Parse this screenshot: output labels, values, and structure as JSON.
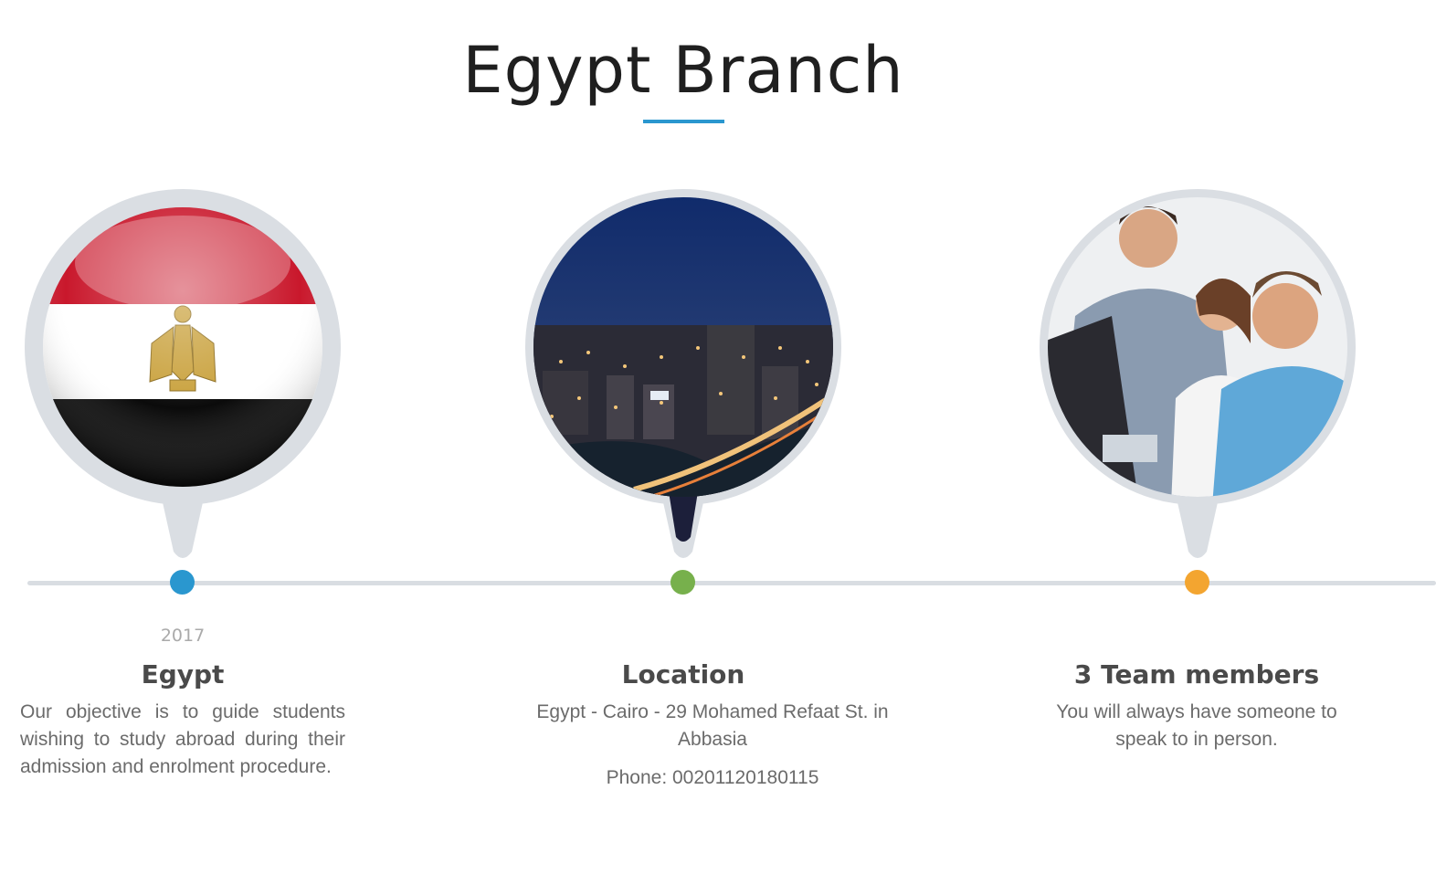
{
  "page": {
    "title": "Egypt Branch"
  },
  "colors": {
    "accent": "#2a97cf",
    "timeline": "#d9dde2",
    "dot_1": "#2a97cf",
    "dot_2": "#77b04c",
    "dot_3": "#f3a530"
  },
  "timeline": {
    "items": [
      {
        "image": "egypt-flag",
        "year": "2017",
        "title": "Egypt",
        "description": "Our objective is to guide students wishing to study abroad during their admission and enrolment procedure."
      },
      {
        "image": "cairo-night-city",
        "title": "Location",
        "description": "Egypt - Cairo - 29 Mohamed Refaat St. in Abbasia",
        "phone": "Phone: 00201120180115"
      },
      {
        "image": "team-members-photo",
        "title": "3 Team members",
        "description": "You will always have someone to speak to in person."
      }
    ]
  }
}
